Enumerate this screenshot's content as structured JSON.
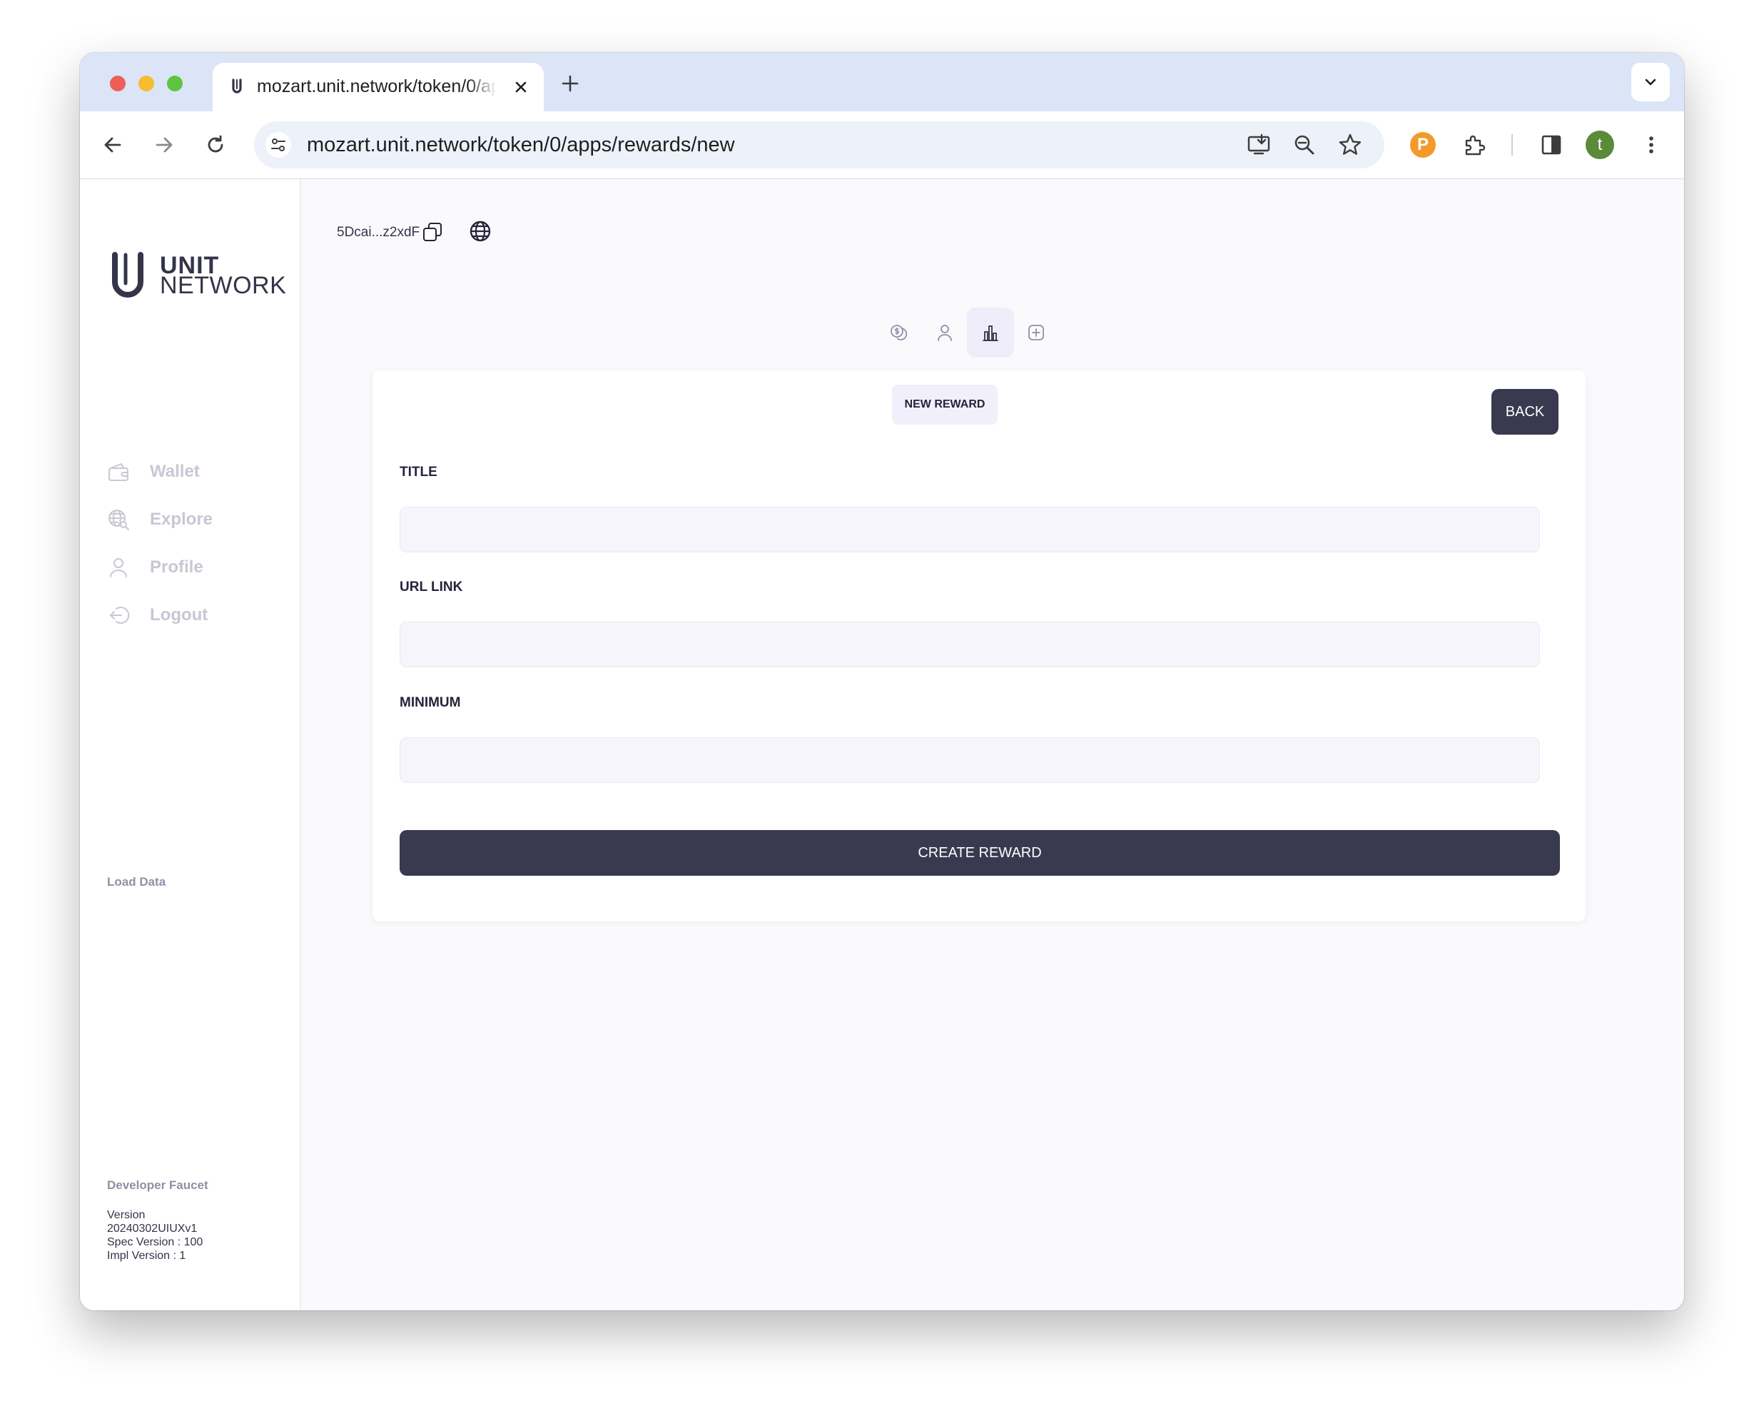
{
  "browser": {
    "tab_title": "mozart.unit.network/token/0/apps/rewards/new",
    "url": "mozart.unit.network/token/0/apps/rewards/new",
    "profile_initial": "t"
  },
  "sidebar": {
    "logo": {
      "line1": "UNIT",
      "line2": "NETWORK"
    },
    "items": [
      {
        "label": "Wallet",
        "icon": "wallet-icon"
      },
      {
        "label": "Explore",
        "icon": "globe-search-icon"
      },
      {
        "label": "Profile",
        "icon": "user-icon"
      },
      {
        "label": "Logout",
        "icon": "logout-icon"
      }
    ],
    "load_data": "Load Data",
    "developer_faucet": "Developer Faucet",
    "version": {
      "label": "Version",
      "build": "20240302UIUXv1",
      "spec": "Spec Version : 100",
      "impl": "Impl Version : 1"
    }
  },
  "header": {
    "address": "5Dcai...z2xdF"
  },
  "top_tabs": [
    {
      "icon": "coin-icon",
      "active": false
    },
    {
      "icon": "user-icon",
      "active": false
    },
    {
      "icon": "bar-chart-icon",
      "active": true
    },
    {
      "icon": "plus-square-icon",
      "active": false
    }
  ],
  "form": {
    "badge": "NEW REWARD",
    "back_label": "BACK",
    "fields": [
      {
        "label": "TITLE",
        "value": ""
      },
      {
        "label": "URL LINK",
        "value": ""
      },
      {
        "label": "MINIMUM",
        "value": ""
      }
    ],
    "submit_label": "CREATE REWARD"
  },
  "colors": {
    "primary_button": "#393a50",
    "badge_bg": "#f1effa",
    "input_bg": "#f6f5fb",
    "tab_strip": "#dbe5f7",
    "nav_inactive": "#c7c8d4"
  }
}
